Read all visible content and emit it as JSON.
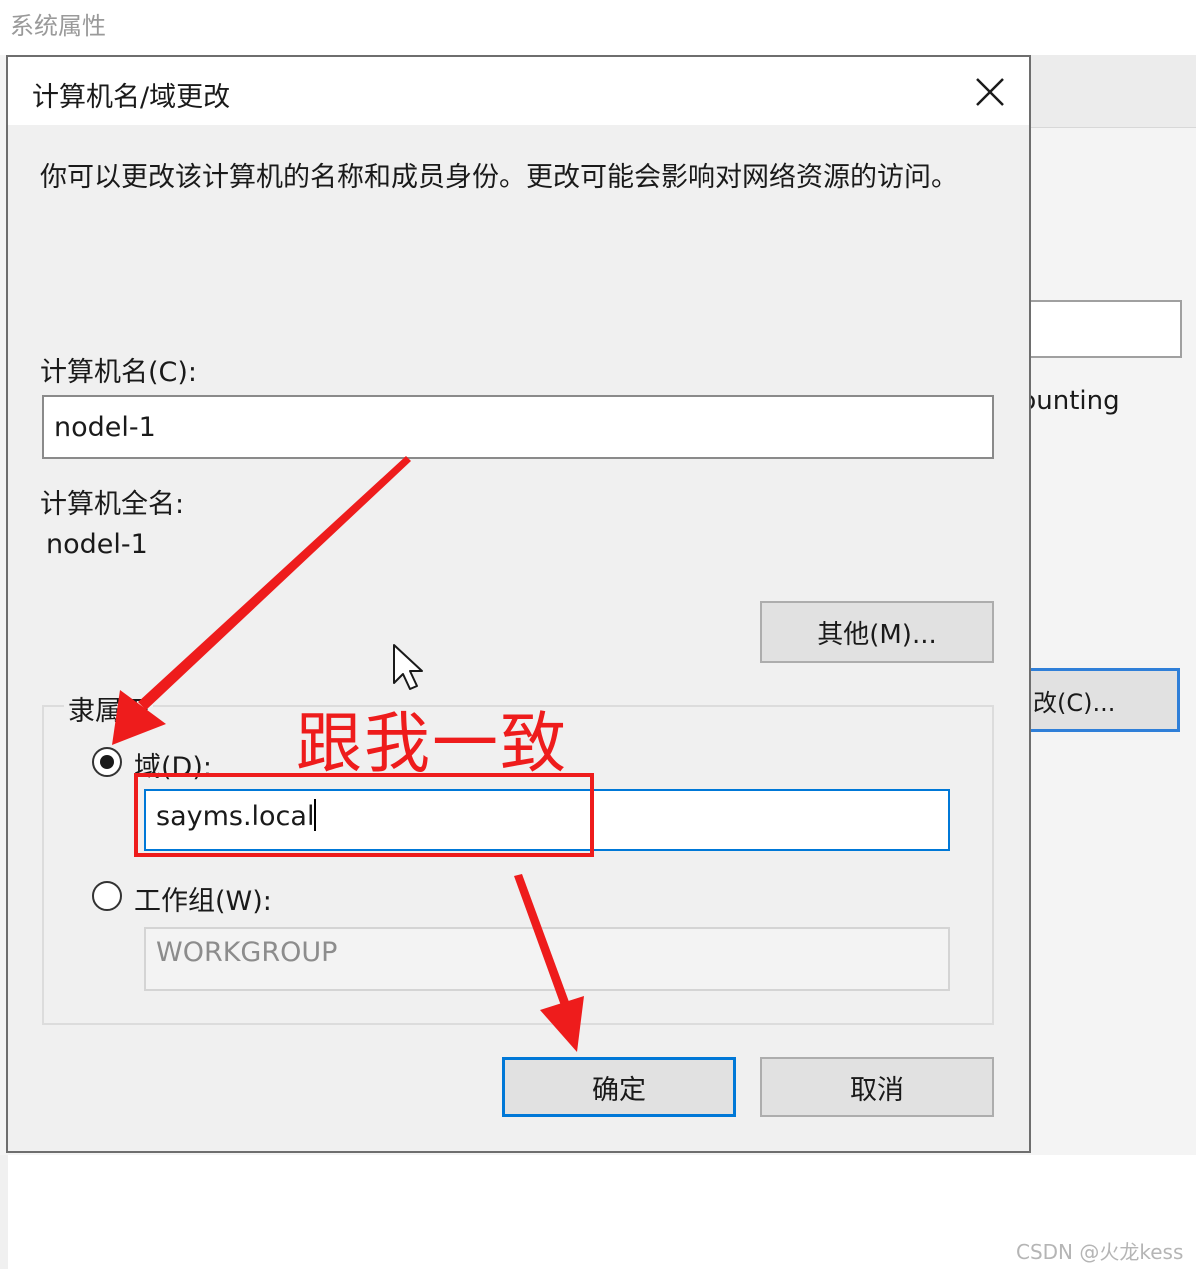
{
  "background_window": {
    "title": "系统属性",
    "text_fragment": "ɔunting",
    "change_button_label": "改(C)..."
  },
  "dialog": {
    "title": "计算机名/域更改",
    "description": "你可以更改该计算机的名称和成员身份。更改可能会影响对网络资源的访问。",
    "computer_name_label": "计算机名(C):",
    "computer_name_value": "nodel-1",
    "full_name_label": "计算机全名:",
    "full_name_value": "nodel-1",
    "more_button_label": "其他(M)...",
    "member_of": {
      "legend": "隶属于",
      "domain_label": "域(D):",
      "domain_selected": true,
      "domain_value": "sayms.local",
      "workgroup_label": "工作组(W):",
      "workgroup_selected": false,
      "workgroup_value": "WORKGROUP"
    },
    "ok_label": "确定",
    "cancel_label": "取消"
  },
  "annotation": {
    "text": "跟我一致",
    "color": "#ee1c1c"
  },
  "watermark": "CSDN @火龙kess",
  "colors": {
    "accent": "#0078d7",
    "annotation_red": "#ee1c1c"
  },
  "icons": [
    "close-icon",
    "mouse-cursor-icon",
    "arrow-annotation"
  ]
}
